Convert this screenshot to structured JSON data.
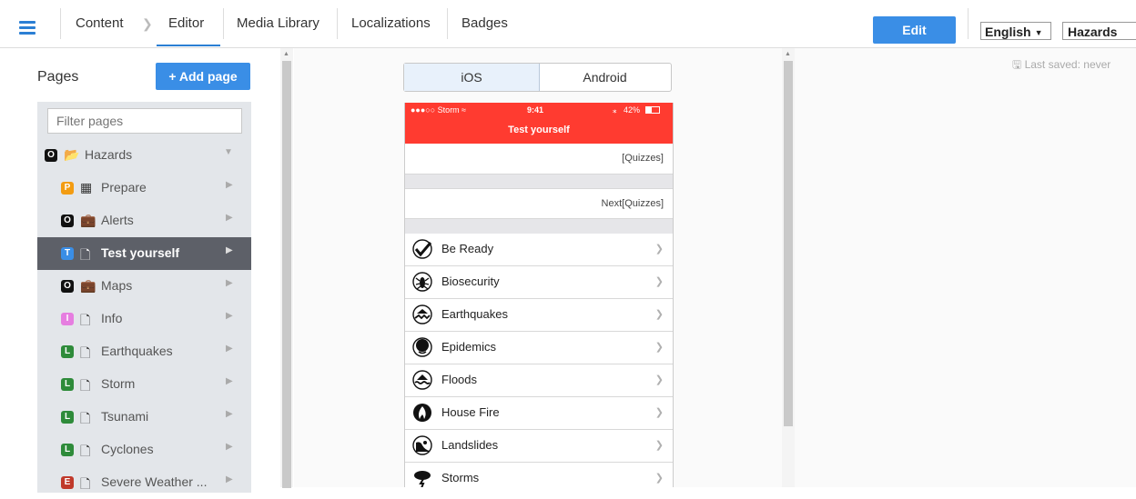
{
  "nav": {
    "content": "Content",
    "editor": "Editor",
    "media_library": "Media Library",
    "localizations": "Localizations",
    "badges": "Badges",
    "edit_button": "Edit",
    "language": "English",
    "project": "Hazards"
  },
  "pages": {
    "title": "Pages",
    "add_button": "+ Add page",
    "filter_placeholder": "Filter pages",
    "items": [
      {
        "badge": "O",
        "icon": "folder-open-icon",
        "label": "Hazards",
        "expanded": true
      },
      {
        "badge": "P",
        "icon": "grid-icon",
        "label": "Prepare"
      },
      {
        "badge": "O",
        "icon": "briefcase-icon",
        "label": "Alerts"
      },
      {
        "badge": "T",
        "icon": "page-icon",
        "label": "Test yourself",
        "active": true
      },
      {
        "badge": "O",
        "icon": "briefcase-icon",
        "label": "Maps"
      },
      {
        "badge": "I",
        "icon": "page-icon",
        "label": "Info"
      },
      {
        "badge": "L",
        "icon": "page-icon",
        "label": "Earthquakes"
      },
      {
        "badge": "L",
        "icon": "page-icon",
        "label": "Storm"
      },
      {
        "badge": "L",
        "icon": "page-icon",
        "label": "Tsunami"
      },
      {
        "badge": "L",
        "icon": "page-icon",
        "label": "Cyclones"
      },
      {
        "badge": "E",
        "icon": "page-icon",
        "label": "Severe Weather ..."
      }
    ]
  },
  "preview": {
    "os_ios": "iOS",
    "os_android": "Android",
    "selected_os": "iOS",
    "status_carrier": "●●●○○ Storm",
    "status_time": "9:41",
    "status_battery": "42%",
    "screen_title": "Test yourself",
    "cell1": "[Quizzes]",
    "cell2": "Next[Quizzes]",
    "list": [
      {
        "label": "Be Ready",
        "icon": "checkmark-icon"
      },
      {
        "label": "Biosecurity",
        "icon": "bug-icon"
      },
      {
        "label": "Earthquakes",
        "icon": "earthquake-icon"
      },
      {
        "label": "Epidemics",
        "icon": "epidemic-icon"
      },
      {
        "label": "Floods",
        "icon": "flood-icon"
      },
      {
        "label": "House Fire",
        "icon": "fire-icon"
      },
      {
        "label": "Landslides",
        "icon": "landslide-icon"
      },
      {
        "label": "Storms",
        "icon": "storm-icon"
      }
    ]
  },
  "last_saved": "Last saved: never",
  "colors": {
    "accent": "#3a8ee6",
    "ios_navbar": "#ff3b30",
    "badge_O": "#111111",
    "badge_P": "#f39c12",
    "badge_T": "#3a8ee6",
    "badge_I": "#e67ee0",
    "badge_L": "#2e8b3a",
    "badge_E": "#c0392b"
  }
}
